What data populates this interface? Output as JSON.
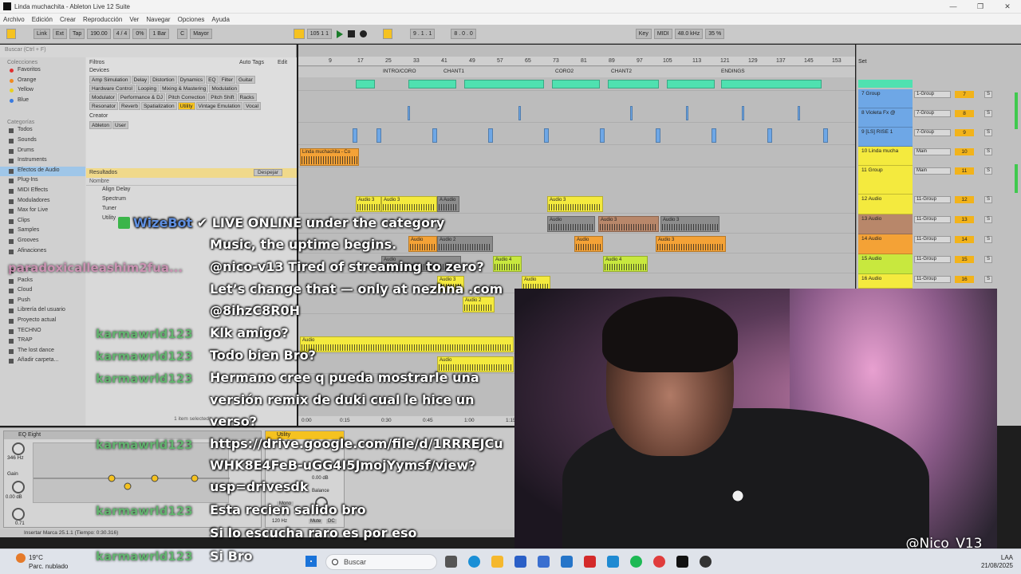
{
  "window": {
    "title": "Linda muchachita - Ableton Live 12 Suite",
    "controls": [
      "—",
      "❐",
      "✕"
    ]
  },
  "menu": [
    "Archivo",
    "Edición",
    "Crear",
    "Reproducción",
    "Ver",
    "Navegar",
    "Opciones",
    "Ayuda"
  ],
  "transport": {
    "link": "Link",
    "ext": "Ext",
    "tap": "Tap",
    "tempo": "190.00",
    "signature": "4 / 4",
    "percent": "0%",
    "quantize": "1 Bar",
    "key": "C",
    "scale": "Mayor",
    "position": "105    1    1",
    "loop_start": "9 .  1 .  1",
    "loop_length": "8 .  0 .  0",
    "key_btn": "Key",
    "midi_btn": "MIDI",
    "sample_rate": "48.0 kHz",
    "cpu": "35 %"
  },
  "browser": {
    "search_placeholder": "Buscar (Ctrl + F)",
    "collections_title": "Colecciones",
    "collections": [
      {
        "label": "Favoritos",
        "color": "#e03030"
      },
      {
        "label": "Orange",
        "color": "#f08a20"
      },
      {
        "label": "Yellow",
        "color": "#e8d020"
      },
      {
        "label": "Blue",
        "color": "#3a7be0"
      }
    ],
    "categories_title": "Categorías",
    "categories": [
      "Todos",
      "Sounds",
      "Drums",
      "Instruments",
      "Efectos de Audio",
      "Plug-Ins",
      "MIDI Effects",
      "Moduladores",
      "Max for Live",
      "Clips",
      "Samples",
      "Grooves",
      "Afinaciones"
    ],
    "active_category": "Efectos de Audio",
    "places": [
      "Places",
      "Packs",
      "Cloud",
      "Push",
      "Librería del usuario",
      "Proyecto actual",
      "TECHNO",
      "TRAP",
      "The lost dance",
      "Añadir carpeta..."
    ],
    "filters_title": "Filtros",
    "auto_tags": "Auto Tags",
    "edit": "Edit",
    "devices_label": "Devices",
    "creator_label": "Creator",
    "creator_tags": [
      "Ableton",
      "User"
    ],
    "tags": [
      [
        "Amp Simulation",
        "Delay",
        "Distortion",
        "Dynamics",
        "EQ",
        "Filter",
        "Guitar"
      ],
      [
        "Hardware Control",
        "Looping",
        "Mixing & Mastering",
        "Modulation"
      ],
      [
        "Modulator",
        "Performance & DJ",
        "Pitch Correction",
        "Pitch Shift",
        "Racks"
      ],
      [
        "Resonator",
        "Reverb",
        "Spatialization",
        "Utility",
        "Vintage Emulation",
        "Vocal"
      ]
    ],
    "highlighted_tag": "Utility",
    "results_title": "Resultados",
    "clear_button": "Despejar",
    "name_col": "Nombre",
    "results": [
      "Align Delay",
      "Spectrum",
      "Tuner",
      "Utility"
    ],
    "footer": "1 item selected"
  },
  "arrangement": {
    "ruler": [
      "9",
      "17",
      "25",
      "33",
      "41",
      "49",
      "57",
      "65",
      "73",
      "81",
      "89",
      "97",
      "105",
      "113",
      "121",
      "129",
      "137",
      "145",
      "153"
    ],
    "locators": [
      "INTRO/CORO",
      "CHANT1",
      "CORO2",
      "CHANT2",
      "ENDINGS"
    ],
    "time_marks": [
      "0:00",
      "0:15",
      "0:30",
      "0:45",
      "1:00",
      "1:15"
    ],
    "clips": {
      "linda": "Linda muchachita - Co",
      "audio3": "Audio 3",
      "audio2": "Audio 2",
      "audio4": "Audio 4",
      "audio": "Audio",
      "a_audio": "A Audio"
    }
  },
  "mixer": {
    "set": "Set",
    "tracks": [
      {
        "name": "7 Group",
        "io": "1-Group",
        "num": "7",
        "color": "#6ea7e6"
      },
      {
        "name": "8 Violeta Fx @",
        "io": "7-Group",
        "num": "8",
        "color": "#6ea7e6"
      },
      {
        "name": "9 [LS] RISE 1",
        "io": "7-Group",
        "num": "9",
        "color": "#6ea7e6"
      },
      {
        "name": "10 Linda mucha",
        "io": "Main",
        "num": "10",
        "color": "#f4ea3e"
      },
      {
        "name": "11 Group",
        "io": "Main",
        "num": "11",
        "color": "#f4ea3e"
      },
      {
        "name": "12 Audio",
        "io": "11-Group",
        "num": "12",
        "color": "#f4ea3e"
      },
      {
        "name": "13 Audio",
        "io": "11-Group",
        "num": "13",
        "color": "#b8876a"
      },
      {
        "name": "14 Audio",
        "io": "11-Group",
        "num": "14",
        "color": "#f4a236"
      },
      {
        "name": "15 Audio",
        "io": "11-Group",
        "num": "15",
        "color": "#c8e83e"
      },
      {
        "name": "16 Audio",
        "io": "11-Group",
        "num": "16",
        "color": "#f4ea3e"
      }
    ],
    "solo": "S"
  },
  "devices": {
    "eq_title": "EQ Eight",
    "eq_freq": "346 Hz",
    "eq_gain": "Gain",
    "eq_gain_val": "0.00 dB",
    "eq_q": "0.71",
    "utility_title": "Utility",
    "utility_gain": "0.00 dB",
    "utility_mono": "Mono",
    "utility_bass": "120 Hz",
    "utility_balance": "Balance",
    "utility_mute": "Mute",
    "utility_dc": "DC"
  },
  "status_bar": "Insertar Marca 25.1.1 (Tiempo: 0:30.316)",
  "taskbar": {
    "temp": "19°C",
    "weather": "Parc. nublado",
    "search": "Buscar",
    "lang": "LAA",
    "date": "21/08/2025"
  },
  "chat": {
    "bot_name": "WizeBot",
    "bot_text": "✔ LIVE ONLINE under the category",
    "lines": [
      {
        "user": "",
        "text": "Music, the uptime begins."
      },
      {
        "user": "paradoxicalleashim2fua...",
        "text": "@nico-v13 Tired of streaming to zero?"
      },
      {
        "user": "",
        "text": "Let’s change that — only at nezhna .com"
      },
      {
        "user": "",
        "text": "@8ihzC8R0H"
      },
      {
        "user": "karmawrld123",
        "text": "Klk amigo?"
      },
      {
        "user": "karmawrld123",
        "text": "Todo bien Bro?"
      },
      {
        "user": "karmawrld123",
        "text": "Hermano cree q pueda mostrarle una"
      },
      {
        "user": "",
        "text": "versión remix de duki cual le hice un"
      },
      {
        "user": "",
        "text": "verso?"
      },
      {
        "user": "karmawrld123",
        "text": "https://drive.google.com/file/d/1RRREJCu"
      },
      {
        "user": "",
        "text": "WHK8E4FeB-uGG4I5JmojYymsf/view?"
      },
      {
        "user": "",
        "text": "usp=drivesdk"
      },
      {
        "user": "karmawrld123",
        "text": "Esta recien salido bro"
      },
      {
        "user": "",
        "text": "Si lo escucha raro es por eso"
      },
      {
        "user": "karmawrld123",
        "text": "Si Bro"
      }
    ]
  },
  "webcam": {
    "handle": "@Nico_V13_"
  }
}
